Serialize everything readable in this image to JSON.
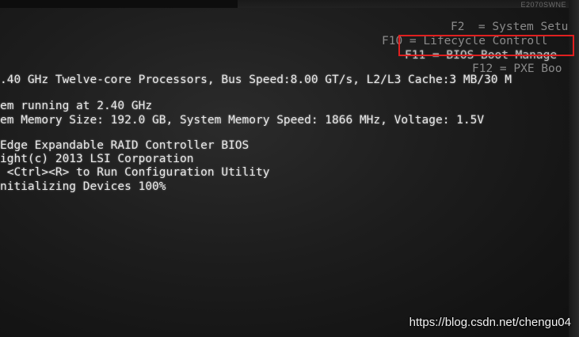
{
  "bezel": {
    "brand": "E2070SWNE"
  },
  "bios": {
    "hotkeys": {
      "f2": "F2  = System Setu",
      "f10": "F10 = Lifecycle Controll",
      "f11": "F11 = BIOS Boot Manage",
      "f12": "F12 = PXE Boo"
    },
    "cpu_line": ".40 GHz Twelve-core Processors, Bus Speed:8.00 GT/s, L2/L3 Cache:3 MB/30 M",
    "system_running": "em running at 2.40 GHz",
    "memory_line": "em Memory Size: 192.0 GB, System Memory Speed: 1866 MHz, Voltage: 1.5V",
    "raid_title": "Edge Expandable RAID Controller BIOS",
    "copyright": "ight(c) 2013 LSI Corporation",
    "press_ctrl": " <Ctrl><R> to Run Configuration Utility",
    "initializing": "nitializing Devices 100%"
  },
  "annotation": {
    "highlight_color": "#e02020"
  },
  "watermark": "https://blog.csdn.net/chengu04"
}
